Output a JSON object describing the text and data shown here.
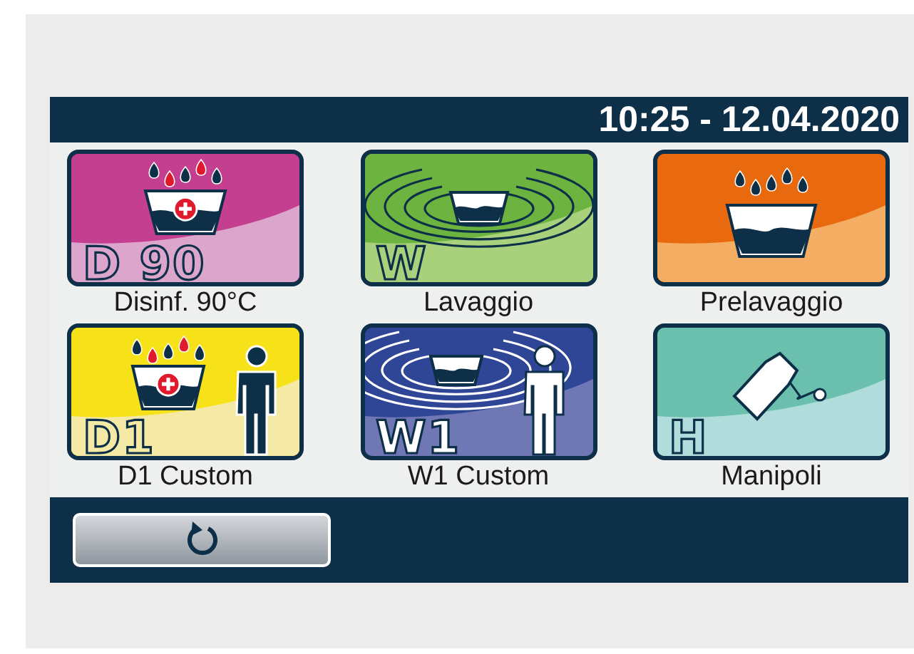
{
  "header": {
    "datetime": "10:25 - 12.04.2020"
  },
  "programs": [
    {
      "kind": "disinfect",
      "code": "D 90",
      "label": "Disinf. 90°C"
    },
    {
      "kind": "wash",
      "code": "W",
      "label": "Lavaggio"
    },
    {
      "kind": "prewash",
      "label": "Prelavaggio"
    },
    {
      "kind": "disinfect-custom",
      "code": "D1",
      "label": "D1 Custom"
    },
    {
      "kind": "wash-custom",
      "code": "W1",
      "label": "W1 Custom"
    },
    {
      "kind": "handpiece",
      "code": "H",
      "label": "Manipoli"
    }
  ]
}
